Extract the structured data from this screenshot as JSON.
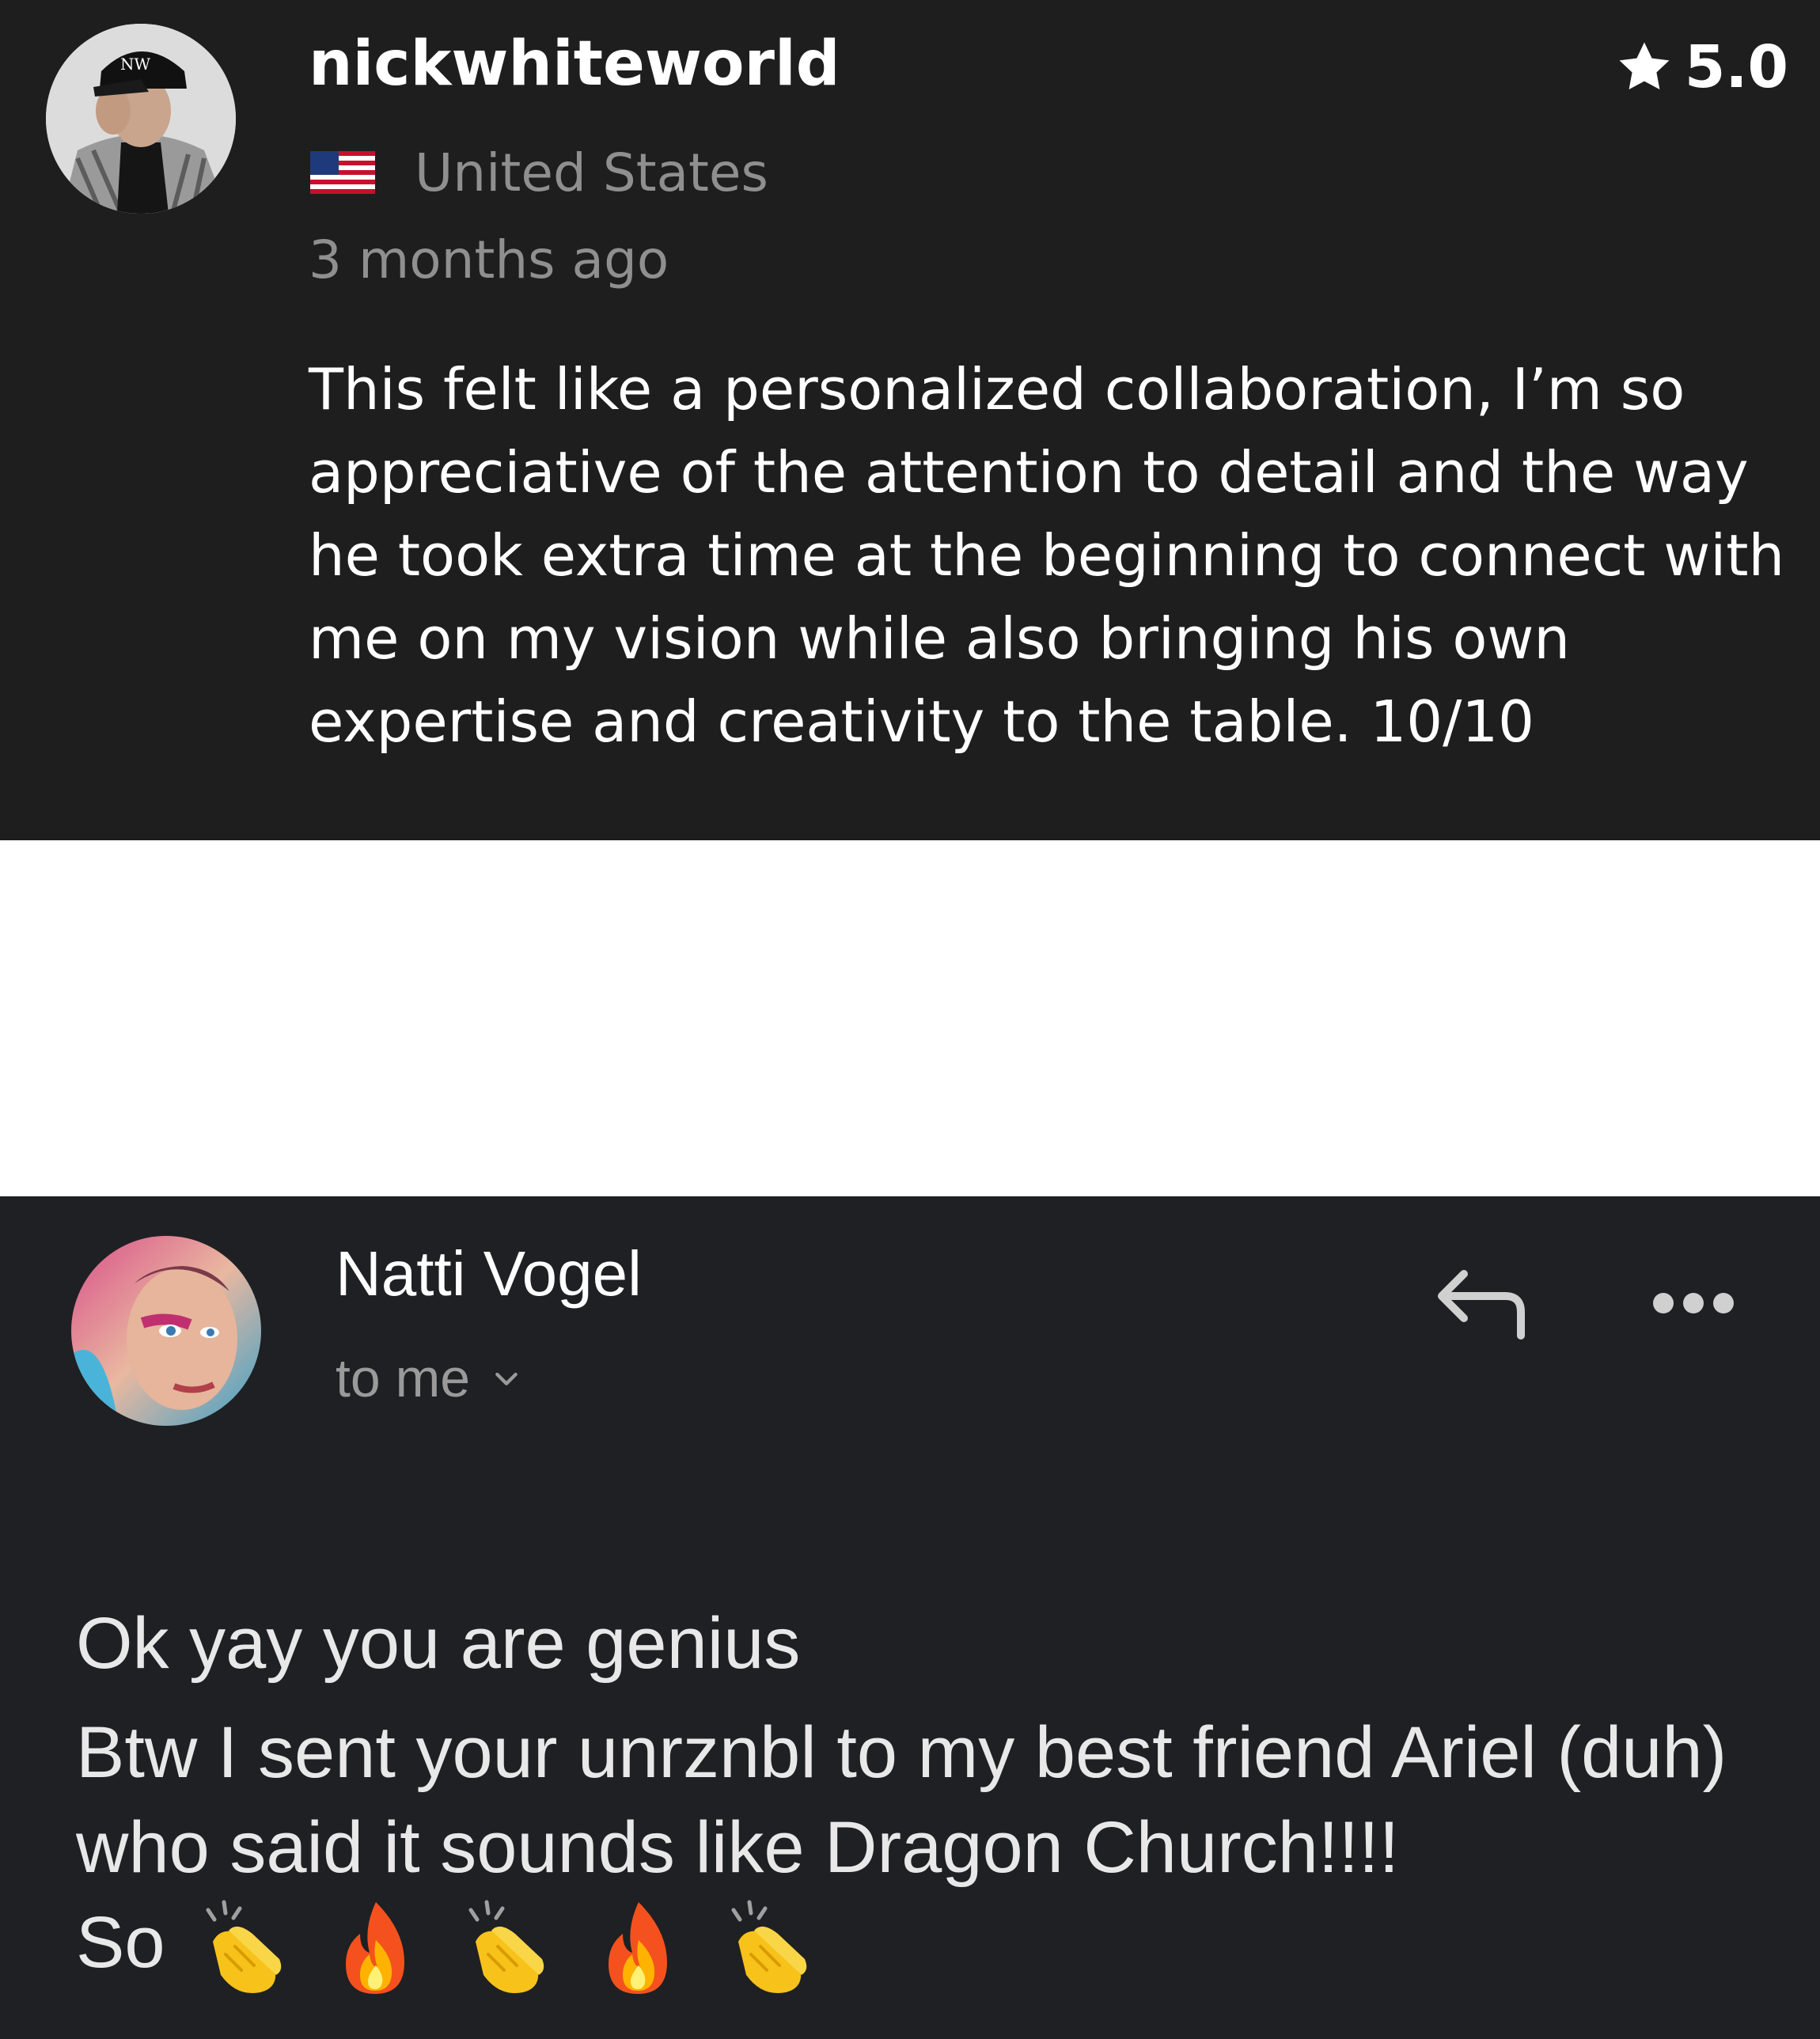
{
  "review": {
    "username": "nickwhiteworld",
    "rating": "5.0",
    "country": "United States",
    "time_ago": "3 months ago",
    "text": "This felt like a personalized collaboration, I’m so appreciative of the attention to detail and the way he took extra time at the beginning to connect with me on my vision while also bringing his own expertise and creativity to the table. 10/10",
    "avatar_cap_text": "NW"
  },
  "email": {
    "sender_name": "Natti Vogel",
    "recipient_label": "to me",
    "body_line1": "Ok yay you are genius",
    "body_line2": "Btw I sent your unrznbl to my best friend Ariel (duh) who said it sounds like Dragon Church!!!!",
    "body_line3_prefix": "So",
    "emojis": [
      "clapping-hands",
      "fire",
      "clapping-hands",
      "fire",
      "clapping-hands"
    ]
  },
  "colors": {
    "review_bg": "#1e1e1e",
    "email_bg": "#1f2023",
    "muted_text": "#8f8f8f",
    "primary_text": "#ffffff"
  }
}
